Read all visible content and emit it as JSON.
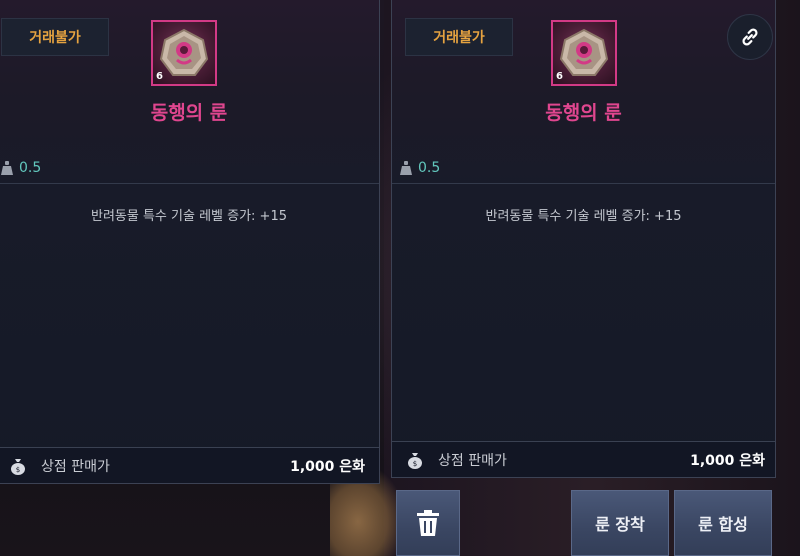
{
  "left_panel": {
    "tag": "거래불가",
    "item_name": "동행의 룬",
    "lock_level": "6",
    "weight": "0.5",
    "effect": "반려동물 특수 기술 레벨 증가: +15",
    "sell_label": "상점 판매가",
    "sell_price": "1,000 은화"
  },
  "right_panel": {
    "tag": "거래불가",
    "item_name": "동행의 룬",
    "lock_level": "6",
    "weight": "0.5",
    "effect": "반려동물 특수 기술 레벨 증가: +15",
    "sell_label": "상점 판매가",
    "sell_price": "1,000 은화",
    "link_icon": "link-icon"
  },
  "actions": {
    "delete_icon": "trash-icon",
    "equip_label": "룬 장착",
    "merge_label": "룬 합성"
  },
  "colors": {
    "tag_text": "#e6a340",
    "item_name": "#e0468f",
    "weight": "#62c7bd",
    "icon_border": "#d23a86",
    "button_bg": "#3a4662"
  }
}
